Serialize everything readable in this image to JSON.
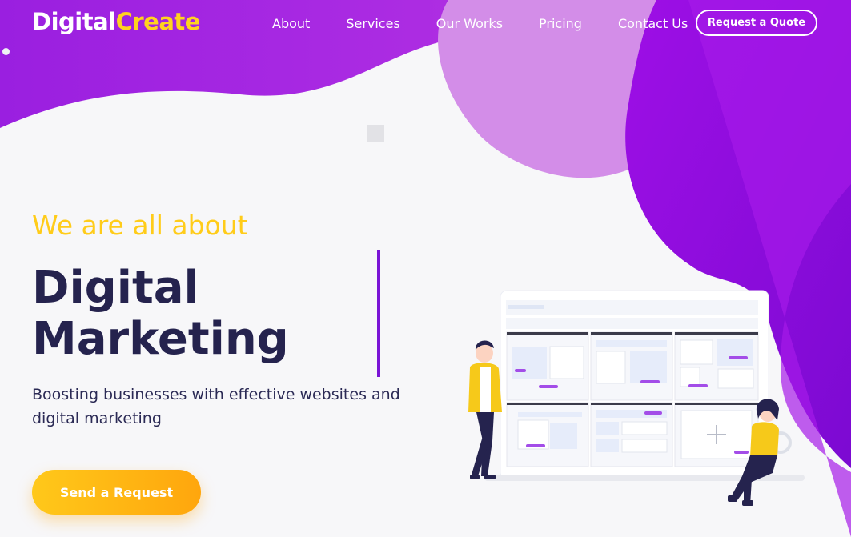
{
  "brand": {
    "part1": "Digital",
    "part2": "Create"
  },
  "nav": {
    "links": [
      "About",
      "Services",
      "Our Works",
      "Pricing",
      "Contact Us"
    ],
    "cta_label": "Request a Quote"
  },
  "hero": {
    "kicker": "We are all about",
    "headline_line1": "Digital",
    "headline_line2": "Marketing",
    "subtitle": "Boosting businesses with effective websites and digital marketing",
    "button_label": "Send a Request"
  },
  "colors": {
    "brand_purple": "#8c12e0",
    "accent_yellow": "#ffd21f",
    "heading_navy": "#25234e"
  }
}
